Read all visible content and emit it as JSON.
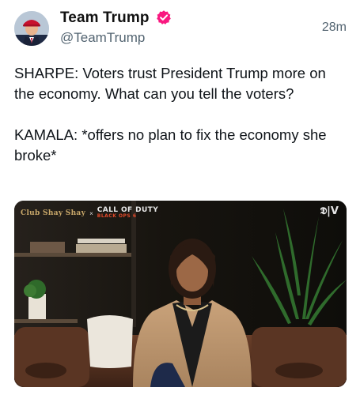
{
  "author": {
    "display_name": "Team Trump",
    "handle": "@TeamTrump",
    "verified_icon": "verified-badge-icon",
    "verified_color": "#f91880"
  },
  "timestamp": "28m",
  "tweet": {
    "paragraph_1": "SHARPE: Voters trust President Trump more on the economy. What can you tell the voters?",
    "paragraph_2": "KAMALA: *offers no plan to fix the economy she broke*"
  },
  "media": {
    "overlay_left_logo": "Club Shay Shay",
    "overlay_x": "×",
    "overlay_cod_title": "CALL OF DUTY",
    "overlay_cod_subtitle": "BLACK OPS 6",
    "overlay_right_brand": "𝕯|V",
    "play_state": "video-paused"
  }
}
